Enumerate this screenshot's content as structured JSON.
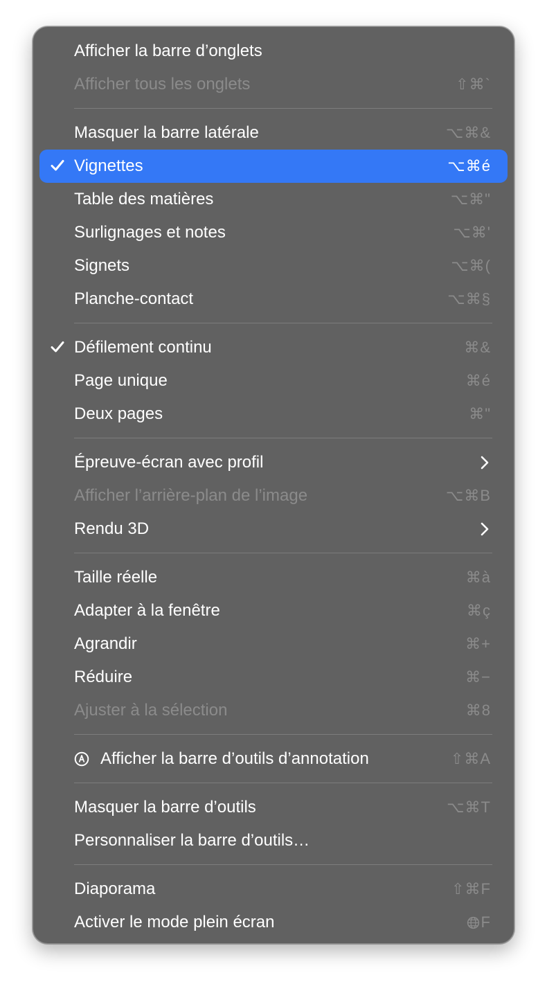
{
  "menu": {
    "group1": [
      {
        "label": "Afficher la barre d’onglets",
        "shortcut": ""
      },
      {
        "label": "Afficher tous les onglets",
        "shortcut": "⇧⌘`"
      }
    ],
    "group2": [
      {
        "label": "Masquer la barre latérale",
        "shortcut": "⌥⌘&"
      },
      {
        "label": "Vignettes",
        "shortcut": "⌥⌘é"
      },
      {
        "label": "Table des matières",
        "shortcut": "⌥⌘\""
      },
      {
        "label": "Surlignages et notes",
        "shortcut": "⌥⌘'"
      },
      {
        "label": "Signets",
        "shortcut": "⌥⌘("
      },
      {
        "label": "Planche-contact",
        "shortcut": "⌥⌘§"
      }
    ],
    "group3": [
      {
        "label": "Défilement continu",
        "shortcut": "⌘&"
      },
      {
        "label": "Page unique",
        "shortcut": "⌘é"
      },
      {
        "label": "Deux pages",
        "shortcut": "⌘\""
      }
    ],
    "group4": [
      {
        "label": "Épreuve-écran avec profil",
        "shortcut": ""
      },
      {
        "label": "Afficher l’arrière-plan de l’image",
        "shortcut": "⌥⌘B"
      },
      {
        "label": "Rendu 3D",
        "shortcut": ""
      }
    ],
    "group5": [
      {
        "label": "Taille réelle",
        "shortcut": "⌘à"
      },
      {
        "label": "Adapter à la fenêtre",
        "shortcut": "⌘ç"
      },
      {
        "label": "Agrandir",
        "shortcut": "⌘+"
      },
      {
        "label": "Réduire",
        "shortcut": "⌘−"
      },
      {
        "label": "Ajuster à la sélection",
        "shortcut": "⌘8"
      }
    ],
    "group6": [
      {
        "label": "Afficher la barre d’outils d’annotation",
        "shortcut": "⇧⌘A"
      }
    ],
    "group7": [
      {
        "label": "Masquer la barre d’outils",
        "shortcut": "⌥⌘T"
      },
      {
        "label": "Personnaliser la barre d’outils…",
        "shortcut": ""
      }
    ],
    "group8": [
      {
        "label": "Diaporama",
        "shortcut": "⇧⌘F"
      },
      {
        "label": "Activer le mode plein écran",
        "shortcut": "F"
      }
    ]
  },
  "icons": {
    "check": "checkmark-icon",
    "submenu": "chevron-right-icon",
    "markup": "markup-pen-icon",
    "globe": "globe-icon"
  },
  "colors": {
    "menu_bg": "#616161",
    "highlight": "#3478f6",
    "text": "#ffffff",
    "disabled": "#8b8b8b"
  }
}
